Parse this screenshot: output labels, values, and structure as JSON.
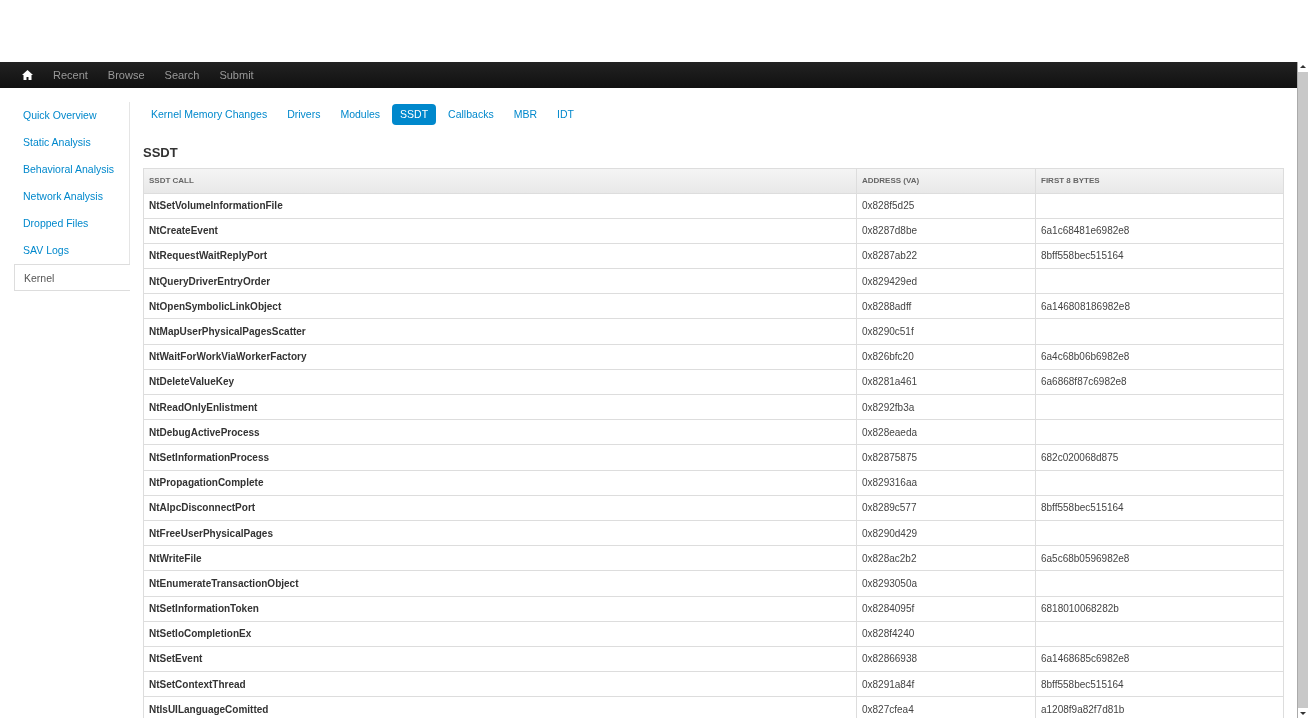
{
  "navbar": {
    "items": [
      {
        "kind": "home"
      },
      {
        "kind": "link",
        "label": "Recent"
      },
      {
        "kind": "link",
        "label": "Browse"
      },
      {
        "kind": "link",
        "label": "Search"
      },
      {
        "kind": "link",
        "label": "Submit"
      }
    ]
  },
  "sidebar": {
    "items": [
      {
        "label": "Quick Overview",
        "selected": false
      },
      {
        "label": "Static Analysis",
        "selected": false
      },
      {
        "label": "Behavioral Analysis",
        "selected": false
      },
      {
        "label": "Network Analysis",
        "selected": false
      },
      {
        "label": "Dropped Files",
        "selected": false
      },
      {
        "label": "SAV Logs",
        "selected": false
      },
      {
        "label": "Kernel",
        "selected": true
      }
    ]
  },
  "tabs": [
    {
      "label": "Kernel Memory Changes",
      "selected": false
    },
    {
      "label": "Drivers",
      "selected": false
    },
    {
      "label": "Modules",
      "selected": false
    },
    {
      "label": "SSDT",
      "selected": true
    },
    {
      "label": "Callbacks",
      "selected": false
    },
    {
      "label": "MBR",
      "selected": false
    },
    {
      "label": "IDT",
      "selected": false
    }
  ],
  "section_title": "SSDT",
  "table": {
    "columns": [
      "SSDT CALL",
      "ADDRESS (VA)",
      "FIRST 8 BYTES"
    ],
    "rows": [
      [
        "NtSetVolumeInformationFile",
        "0x828f5d25",
        ""
      ],
      [
        "NtCreateEvent",
        "0x8287d8be",
        "6a1c68481e6982e8"
      ],
      [
        "NtRequestWaitReplyPort",
        "0x8287ab22",
        "8bff558bec515164"
      ],
      [
        "NtQueryDriverEntryOrder",
        "0x829429ed",
        ""
      ],
      [
        "NtOpenSymbolicLinkObject",
        "0x8288adff",
        "6a146808186982e8"
      ],
      [
        "NtMapUserPhysicalPagesScatter",
        "0x8290c51f",
        ""
      ],
      [
        "NtWaitForWorkViaWorkerFactory",
        "0x826bfc20",
        "6a4c68b06b6982e8"
      ],
      [
        "NtDeleteValueKey",
        "0x8281a461",
        "6a6868f87c6982e8"
      ],
      [
        "NtReadOnlyEnlistment",
        "0x8292fb3a",
        ""
      ],
      [
        "NtDebugActiveProcess",
        "0x828eaeda",
        ""
      ],
      [
        "NtSetInformationProcess",
        "0x82875875",
        "682c020068d875"
      ],
      [
        "NtPropagationComplete",
        "0x829316aa",
        ""
      ],
      [
        "NtAlpcDisconnectPort",
        "0x8289c577",
        "8bff558bec515164"
      ],
      [
        "NtFreeUserPhysicalPages",
        "0x8290d429",
        ""
      ],
      [
        "NtWriteFile",
        "0x828ac2b2",
        "6a5c68b0596982e8"
      ],
      [
        "NtEnumerateTransactionObject",
        "0x8293050a",
        ""
      ],
      [
        "NtSetInformationToken",
        "0x8284095f",
        "6818010068282b"
      ],
      [
        "NtSetIoCompletionEx",
        "0x828f4240",
        ""
      ],
      [
        "NtSetEvent",
        "0x82866938",
        "6a1468685c6982e8"
      ],
      [
        "NtSetContextThread",
        "0x8291a84f",
        "8bff558bec515164"
      ],
      [
        "NtIsUILanguageComitted",
        "0x827cfea4",
        "a1208f9a82f7d81b"
      ]
    ]
  }
}
